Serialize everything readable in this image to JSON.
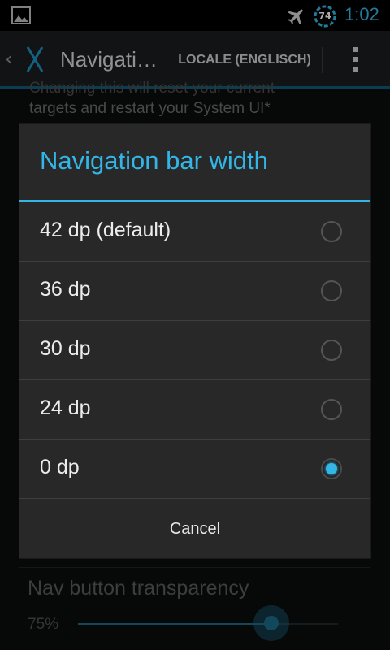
{
  "status_bar": {
    "battery_level": "74",
    "time": "1:02",
    "icons": [
      "image-icon",
      "airplane-mode-icon",
      "battery-icon"
    ]
  },
  "action_bar": {
    "title": "Navigati…",
    "locale_button": "LOCALE (ENGLISCH)",
    "icons": [
      "back-chevron-icon",
      "app-logo-icon",
      "overflow-menu-icon"
    ]
  },
  "background": {
    "summary_line1": "Changing this will reset your current",
    "summary_line2": "targets and restart your System UI*",
    "nav_button_title": "Nav button transparency",
    "nav_button_value": "75%",
    "nav_button_level": 0.75
  },
  "dialog": {
    "title": "Navigation bar width",
    "options": [
      {
        "label": "42 dp (default)",
        "checked": false
      },
      {
        "label": "36 dp",
        "checked": false
      },
      {
        "label": "30 dp",
        "checked": false
      },
      {
        "label": "24 dp",
        "checked": false
      },
      {
        "label": "0 dp",
        "checked": true
      }
    ],
    "cancel_label": "Cancel"
  },
  "colors": {
    "accent": "#33b5e5",
    "dialog_bg": "#282828",
    "screen_bg": "#0b0c0d"
  }
}
